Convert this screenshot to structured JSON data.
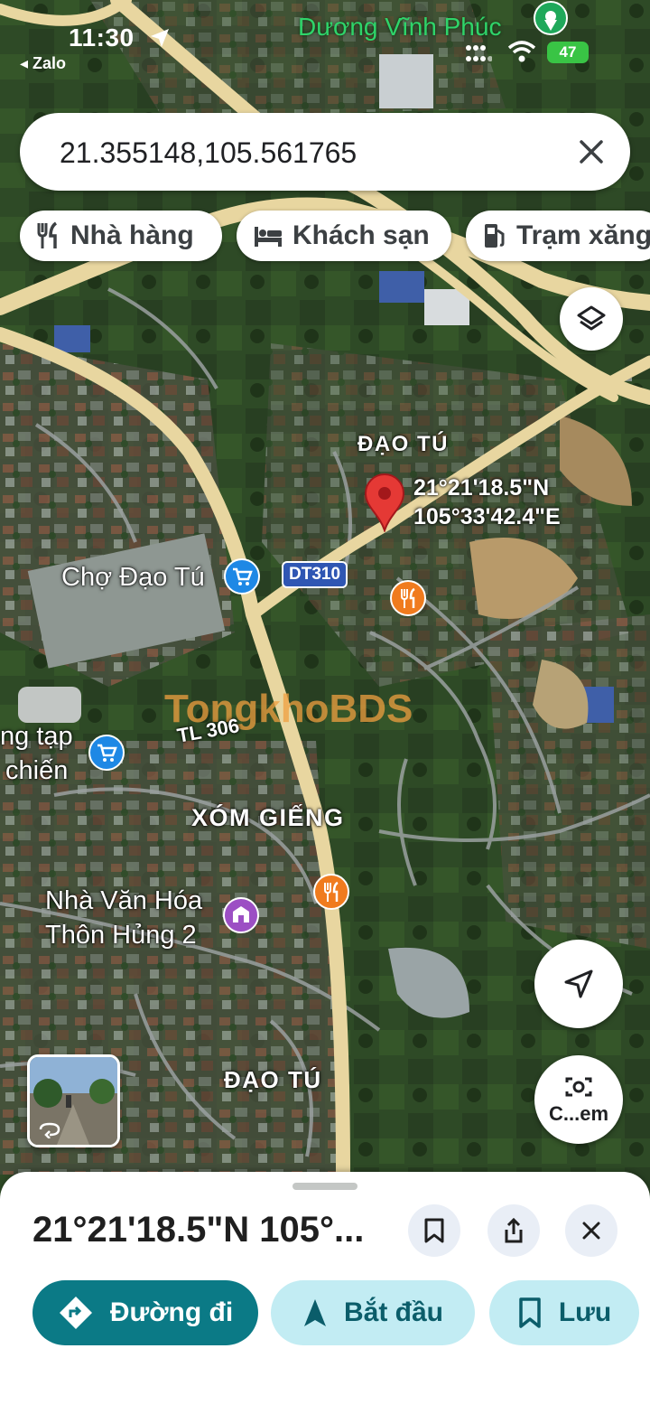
{
  "status_bar": {
    "time": "11:30",
    "back_app": "◂ Zalo",
    "battery": "47",
    "map_place_label": "Dương Vĩnh Phúc"
  },
  "search": {
    "value": "21.355148,105.561765"
  },
  "chips": [
    {
      "label": "Nhà hàng",
      "icon": "restaurant-icon"
    },
    {
      "label": "Khách sạn",
      "icon": "hotel-bed-icon"
    },
    {
      "label": "Trạm xăng",
      "icon": "gas-station-icon"
    }
  ],
  "map": {
    "pin_coords": {
      "lat": "21°21'18.5\"N",
      "lng": "105°33'42.4\"E"
    },
    "labels": {
      "dao_tu_top": "ĐẠO TÚ",
      "cho_dao_tu": "Chợ Đạo Tú",
      "dt310": "DT310",
      "tl306": "TL 306",
      "tap_line1": "ng tạp",
      "tap_line2": "chiến",
      "xom_gieng": "XÓM GIẾNG",
      "nha_van_hoa_1": "Nhà Văn Hóa",
      "nha_van_hoa_2": "Thôn Hủng 2",
      "dao_tu_bottom": "ĐẠO TÚ",
      "watermark": "TongkhoBDS"
    },
    "camera_label": "C...em",
    "colors": {
      "road": "#e8d6a0",
      "pin": "#e53935",
      "restaurant_poi": "#f07b1e",
      "shop_poi": "#1e88e5",
      "culture_poi": "#9c4fc4"
    }
  },
  "sheet": {
    "title": "21°21'18.5\"N 105°...",
    "actions": {
      "directions": "Đường đi",
      "start": "Bắt đầu",
      "save": "Lưu"
    },
    "accent": "#0b7a86"
  }
}
